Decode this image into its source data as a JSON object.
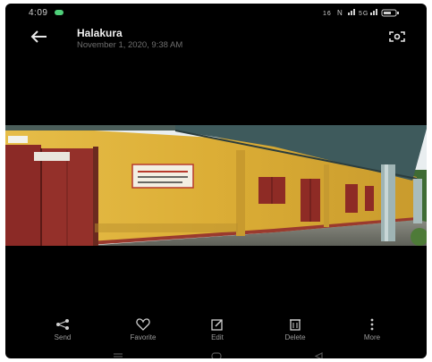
{
  "status_bar": {
    "time": "4:09",
    "indicators": "¹⁶⁄₈ ℕ ⁵ᴳ ıl ıl ▭"
  },
  "header": {
    "title": "Halakura",
    "subtitle": "November 1, 2020, 9:38 AM",
    "back_icon": "arrow-left-icon",
    "lens_icon": "google-lens-icon"
  },
  "photo": {
    "sign_text": "বাংলা স্কুল"
  },
  "actions": [
    {
      "label": "Send",
      "icon": "share-icon"
    },
    {
      "label": "Favorite",
      "icon": "heart-icon"
    },
    {
      "label": "Edit",
      "icon": "edit-icon"
    },
    {
      "label": "Delete",
      "icon": "trash-icon"
    },
    {
      "label": "More",
      "icon": "more-icon"
    }
  ],
  "colors": {
    "background": "#000000",
    "wall": "#e2b43c",
    "door": "#8b2a26",
    "roof": "#3e5a5c",
    "sky": "#e9eef0"
  }
}
